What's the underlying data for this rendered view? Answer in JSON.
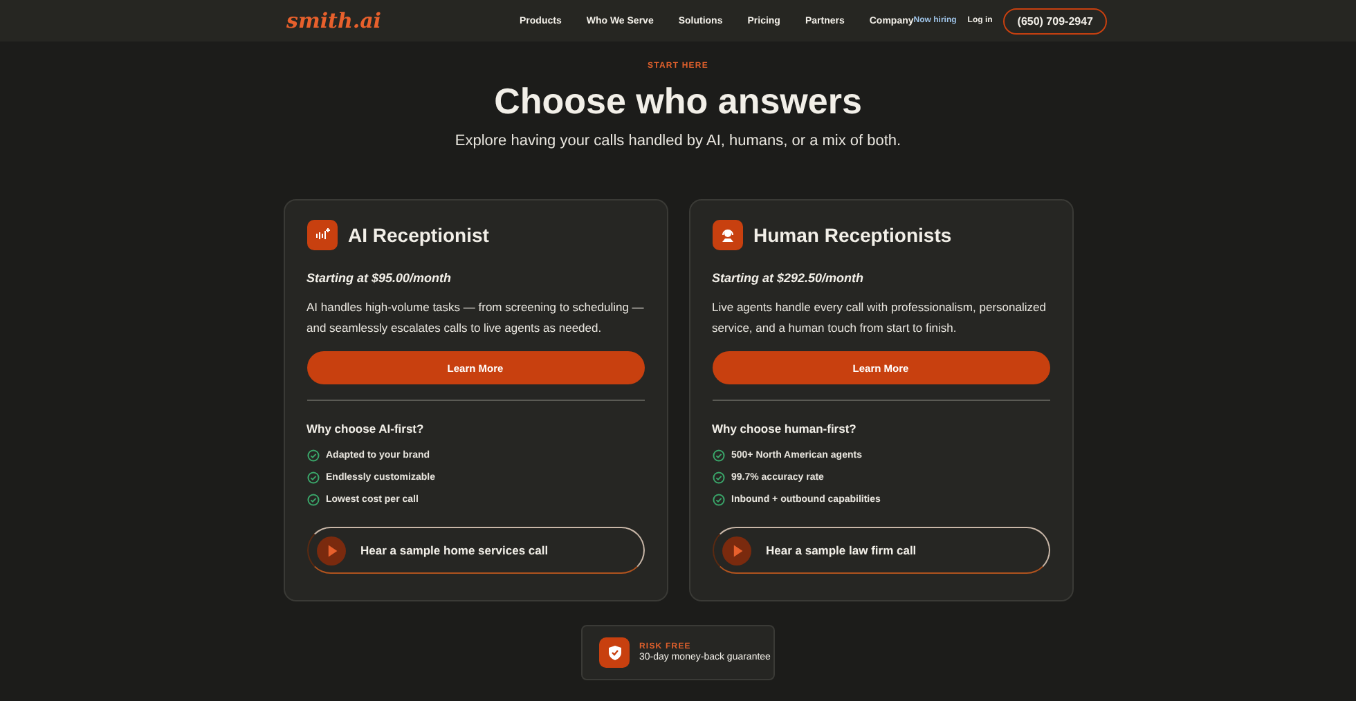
{
  "header": {
    "logo": "smith.ai",
    "nav": [
      "Products",
      "Who We Serve",
      "Solutions",
      "Pricing",
      "Partners",
      "Company"
    ],
    "hiring_link": "Now hiring",
    "login_link": "Log in",
    "phone_button": "(650) 709-2947"
  },
  "hero": {
    "eyebrow": "START HERE",
    "title": "Choose who answers",
    "subtitle": "Explore having your calls handled by AI, humans, or a mix of both."
  },
  "cards": [
    {
      "kind": "ai",
      "title": "AI Receptionist",
      "price": "Starting at $95.00/month",
      "description": "AI handles high-volume tasks — from screening to scheduling — and seamlessly escalates calls to live agents as needed.",
      "button": "Learn More",
      "why_title": "Why choose AI-first?",
      "benefits": [
        "Adapted to your brand",
        "Endlessly customizable",
        "Lowest cost per call"
      ],
      "sample_button": "Hear a sample home services call"
    },
    {
      "kind": "human",
      "title": "Human Receptionists",
      "price": "Starting at $292.50/month",
      "description": "Live agents handle every call with professionalism, personalized service, and a human touch from start to finish.",
      "button": "Learn More",
      "why_title": "Why choose human-first?",
      "benefits": [
        "500+ North American agents",
        "99.7% accuracy rate",
        "Inbound + outbound capabilities"
      ],
      "sample_button": "Hear a sample law firm call"
    }
  ],
  "guarantee": {
    "label": "RISK FREE",
    "text": "30-day money-back guarantee"
  }
}
